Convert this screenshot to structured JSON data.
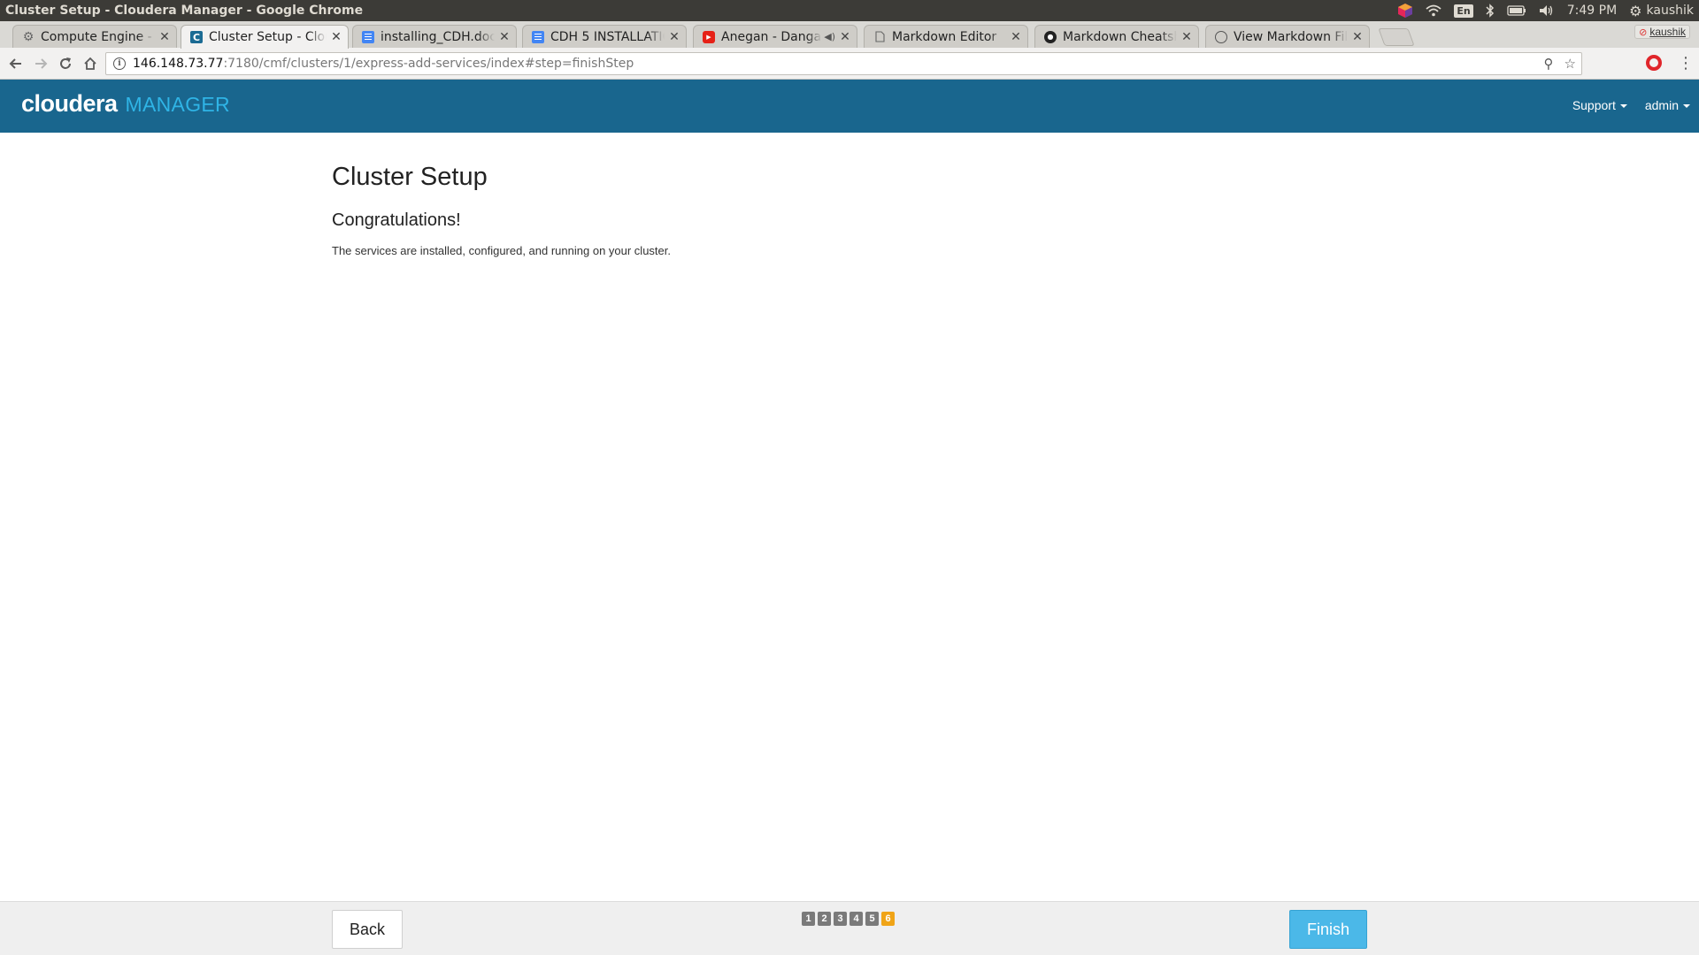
{
  "os": {
    "window_title": "Cluster Setup - Cloudera Manager - Google Chrome",
    "keyboard": "En",
    "time": "7:49 PM",
    "user": "kaushik"
  },
  "browser": {
    "tabs": [
      {
        "label": "Compute Engine - M",
        "icon": "gear-icon",
        "active": false
      },
      {
        "label": "Cluster Setup - Clou",
        "icon": "cloudera-c-icon",
        "active": true
      },
      {
        "label": "installing_CDH.doc",
        "icon": "docs-icon",
        "active": false
      },
      {
        "label": "CDH 5 INSTALLATIC",
        "icon": "docs-icon",
        "active": false
      },
      {
        "label": "Anegan - Danga I",
        "icon": "youtube-icon",
        "active": false
      },
      {
        "label": "Markdown Editor",
        "icon": "page-icon",
        "active": false
      },
      {
        "label": "Markdown Cheatsh",
        "icon": "github-icon",
        "active": false
      },
      {
        "label": "View Markdown Fil",
        "icon": "globe-icon",
        "active": false
      }
    ],
    "profile_name": "kaushik",
    "url_host": "146.148.73.77",
    "url_rest": ":7180/cmf/clusters/1/express-add-services/index#step=finishStep"
  },
  "header": {
    "brand": "cloudera",
    "product": "MANAGER",
    "nav": [
      "Support",
      "admin"
    ]
  },
  "main": {
    "title": "Cluster Setup",
    "subtitle": "Congratulations!",
    "message": "The services are installed, configured, and running on your cluster."
  },
  "footer": {
    "back_label": "Back",
    "finish_label": "Finish",
    "steps": [
      "1",
      "2",
      "3",
      "4",
      "5",
      "6"
    ],
    "current_step": "6"
  },
  "colors": {
    "header_bg": "#19668e",
    "brand_accent": "#2fb4e6",
    "finish_button": "#4bb8e8",
    "current_step": "#f0a417"
  }
}
